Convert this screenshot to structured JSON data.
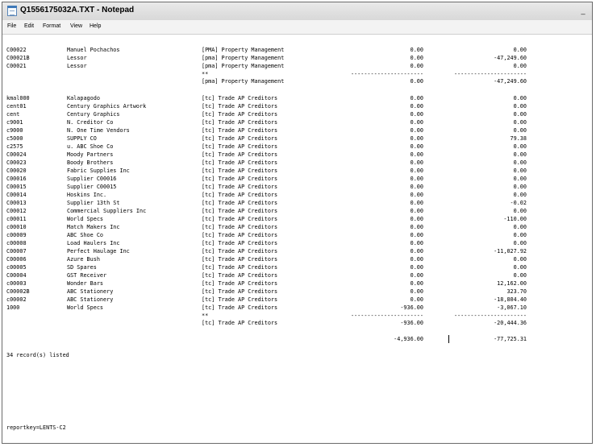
{
  "window": {
    "title": "Q1556175032A.TXT - Notepad",
    "minimize_label": "_"
  },
  "menu": [
    "File",
    "Edit",
    "Format",
    "View",
    "Help"
  ],
  "group1": [
    [
      "C00022",
      "Manuel Pochachos",
      "[PMA] Property Management",
      "0.00",
      "0.00"
    ],
    [
      "C00021B",
      "Lessor",
      "[pma] Property Management",
      "0.00",
      "-47,249.60"
    ],
    [
      "C00021",
      "Lessor",
      "[pma] Property Management",
      "0.00",
      "0.00"
    ]
  ],
  "group1_separator": {
    "marker": "**",
    "dash4": "----------------------",
    "dash5": "----------------------"
  },
  "group1_total": {
    "label": "[pma] Property Management",
    "v4": "0.00",
    "v5": "-47,249.60"
  },
  "group2": [
    [
      "kmal000",
      "Kalapagodo",
      "[tc] Trade AP Creditors",
      "0.00",
      "0.00"
    ],
    [
      "cent01",
      "Century Graphics Artwork",
      "[tc] Trade AP Creditors",
      "0.00",
      "0.00"
    ],
    [
      "cent",
      "Century Graphics",
      "[tc] Trade AP Creditors",
      "0.00",
      "0.00"
    ],
    [
      "c9001",
      "N. Creditor Co",
      "[tc] Trade AP Creditors",
      "0.00",
      "0.00"
    ],
    [
      "c9000",
      "N. One Time Vendors",
      "[tc] Trade AP Creditors",
      "0.00",
      "0.00"
    ],
    [
      "c5000",
      "SUPPLY CO",
      "[tc] Trade AP Creditors",
      "0.00",
      "79.38"
    ],
    [
      "c2575",
      "u. ABC Shoe Co",
      "[tc] Trade AP Creditors",
      "0.00",
      "0.00"
    ],
    [
      "C00024",
      "Moody Partners",
      "[tc] Trade AP Creditors",
      "0.00",
      "0.00"
    ],
    [
      "C00023",
      "Boody Brothers",
      "[tc] Trade AP Creditors",
      "0.00",
      "0.00"
    ],
    [
      "C00020",
      "Fabric Supplies Inc",
      "[tc] Trade AP Creditors",
      "0.00",
      "0.00"
    ],
    [
      "C00016",
      "Supplier C00016",
      "[tc] Trade AP Creditors",
      "0.00",
      "0.00"
    ],
    [
      "C00015",
      "Supplier C00015",
      "[tc] Trade AP Creditors",
      "0.00",
      "0.00"
    ],
    [
      "C00014",
      "Hoskins Inc.",
      "[tc] Trade AP Creditors",
      "0.00",
      "0.00"
    ],
    [
      "C00013",
      "Supplier 13th St",
      "[tc] Trade AP Creditors",
      "0.00",
      "-0.02"
    ],
    [
      "C00012",
      "Commercial Suppliers Inc",
      "[tc] Trade AP Creditors",
      "0.00",
      "0.00"
    ],
    [
      "c00011",
      "World Specs",
      "[tc] Trade AP Creditors",
      "0.00",
      "-110.00"
    ],
    [
      "c00010",
      "Match Makers Inc",
      "[tc] Trade AP Creditors",
      "0.00",
      "0.00"
    ],
    [
      "c00009",
      "ABC Shoe Co",
      "[tc] Trade AP Creditors",
      "0.00",
      "0.00"
    ],
    [
      "c00008",
      "Load Haulers Inc",
      "[tc] Trade AP Creditors",
      "0.00",
      "0.00"
    ],
    [
      "C00007",
      "Perfect Haulage Inc",
      "[tc] Trade AP Creditors",
      "0.00",
      "-11,027.92"
    ],
    [
      "C00006",
      "Azure Bush",
      "[tc] Trade AP Creditors",
      "0.00",
      "0.00"
    ],
    [
      "c00005",
      "SD Spares",
      "[tc] Trade AP Creditors",
      "0.00",
      "0.00"
    ],
    [
      "C00004",
      "GST Receiver",
      "[tc] Trade AP Creditors",
      "0.00",
      "0.00"
    ],
    [
      "c00003",
      "Wonder Bars",
      "[tc] Trade AP Creditors",
      "0.00",
      "12,162.00"
    ],
    [
      "C00002B",
      "ABC Stationery",
      "[tc] Trade AP Creditors",
      "0.00",
      "323.70"
    ],
    [
      "c00002",
      "ABC Stationery",
      "[tc] Trade AP Creditors",
      "0.00",
      "-18,804.40"
    ],
    [
      "1000",
      "World Specs",
      "[tc] Trade AP Creditors",
      "-936.00",
      "-3,067.10"
    ]
  ],
  "group2_separator": {
    "marker": "**",
    "dash4": "----------------------",
    "dash5": "----------------------"
  },
  "group2_total": {
    "label": "[tc] Trade AP Creditors",
    "v4": "-936.00",
    "v5": "-20,444.36"
  },
  "grand_total": {
    "v4": "-4,936.00",
    "v5": "-77,725.31"
  },
  "footer": {
    "records": "34 record(s) listed",
    "reportkey": "reportkey=LENTS-C2"
  }
}
